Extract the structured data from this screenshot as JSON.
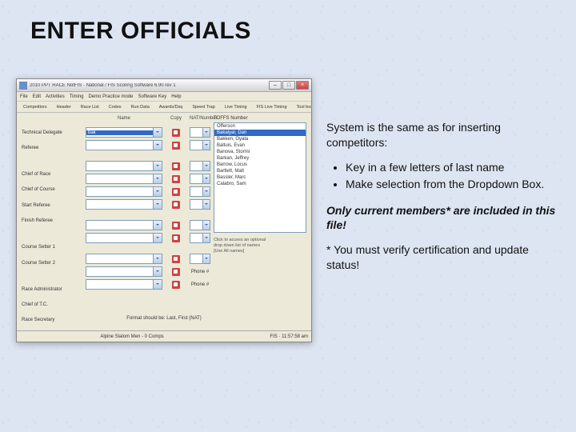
{
  "slide": {
    "title": "ENTER OFFICIALS"
  },
  "app": {
    "title": "2010 PPT RACE NotFIS · National / FIS Scoring Software 6.90 rev 1",
    "menu": [
      "File",
      "Edit",
      "Activities",
      "Timing",
      "Demo Practice mode",
      "Software Key",
      "Help"
    ],
    "toolbar": [
      "Competitors",
      "Header",
      "Race List",
      "Codes",
      "Run Data",
      "Awards/Dsq",
      "Speed Trap",
      "Live Timing",
      "FIS Live Timing",
      "Tool box"
    ],
    "cols": {
      "name": "Name",
      "copy": "Copy",
      "nat": "NAT/Number",
      "toffs": "TOFFS Number"
    },
    "labels": [
      "Technical Delegate",
      "Referee",
      "",
      "Chief of Race",
      "Chief of Course",
      "Start Referee",
      "Finish Referee",
      "",
      "Course Setter 1",
      "Course Setter 2",
      "",
      "Race Administrator",
      "Chief of T.C.",
      "Race Secretary"
    ],
    "names": [
      "bak",
      "",
      "",
      "",
      "",
      "",
      "",
      "",
      "",
      "",
      "",
      "",
      "",
      ""
    ],
    "nat": [
      "",
      "",
      "",
      "",
      "",
      "",
      "",
      "",
      "",
      "",
      "",
      "",
      "",
      ""
    ],
    "footer_label": "Phone #",
    "list": {
      "label": "TOFFS Number",
      "items": [
        "Offerson",
        "Bakalyar, Dan",
        "Bakken, Oyata",
        "Baltuis, Evan",
        "Banova, Stormi",
        "Barkan, Jeffrey",
        "Barrow, Locus",
        "Bartlett, Matt",
        "Bassler, Marc",
        "Calabro, Sam"
      ],
      "selected": 1
    },
    "hint1": "Click to access an optional",
    "hint2": "drop down list of names",
    "hint3": "[Use All names]",
    "bottom": "Format should be: Last, First (NAT)",
    "status_left": "Alpine Slalom Men - 0 Comps",
    "status_right": "FIS · 11:57:58 am"
  },
  "side": {
    "p1": "System is the same as for inserting competitors:",
    "b1": "Key in a few letters of last name",
    "b2": "Make selection from the Dropdown Box.",
    "p2": "Only current members* are included in this file!",
    "p3": "* You must verify certification and update status!"
  }
}
